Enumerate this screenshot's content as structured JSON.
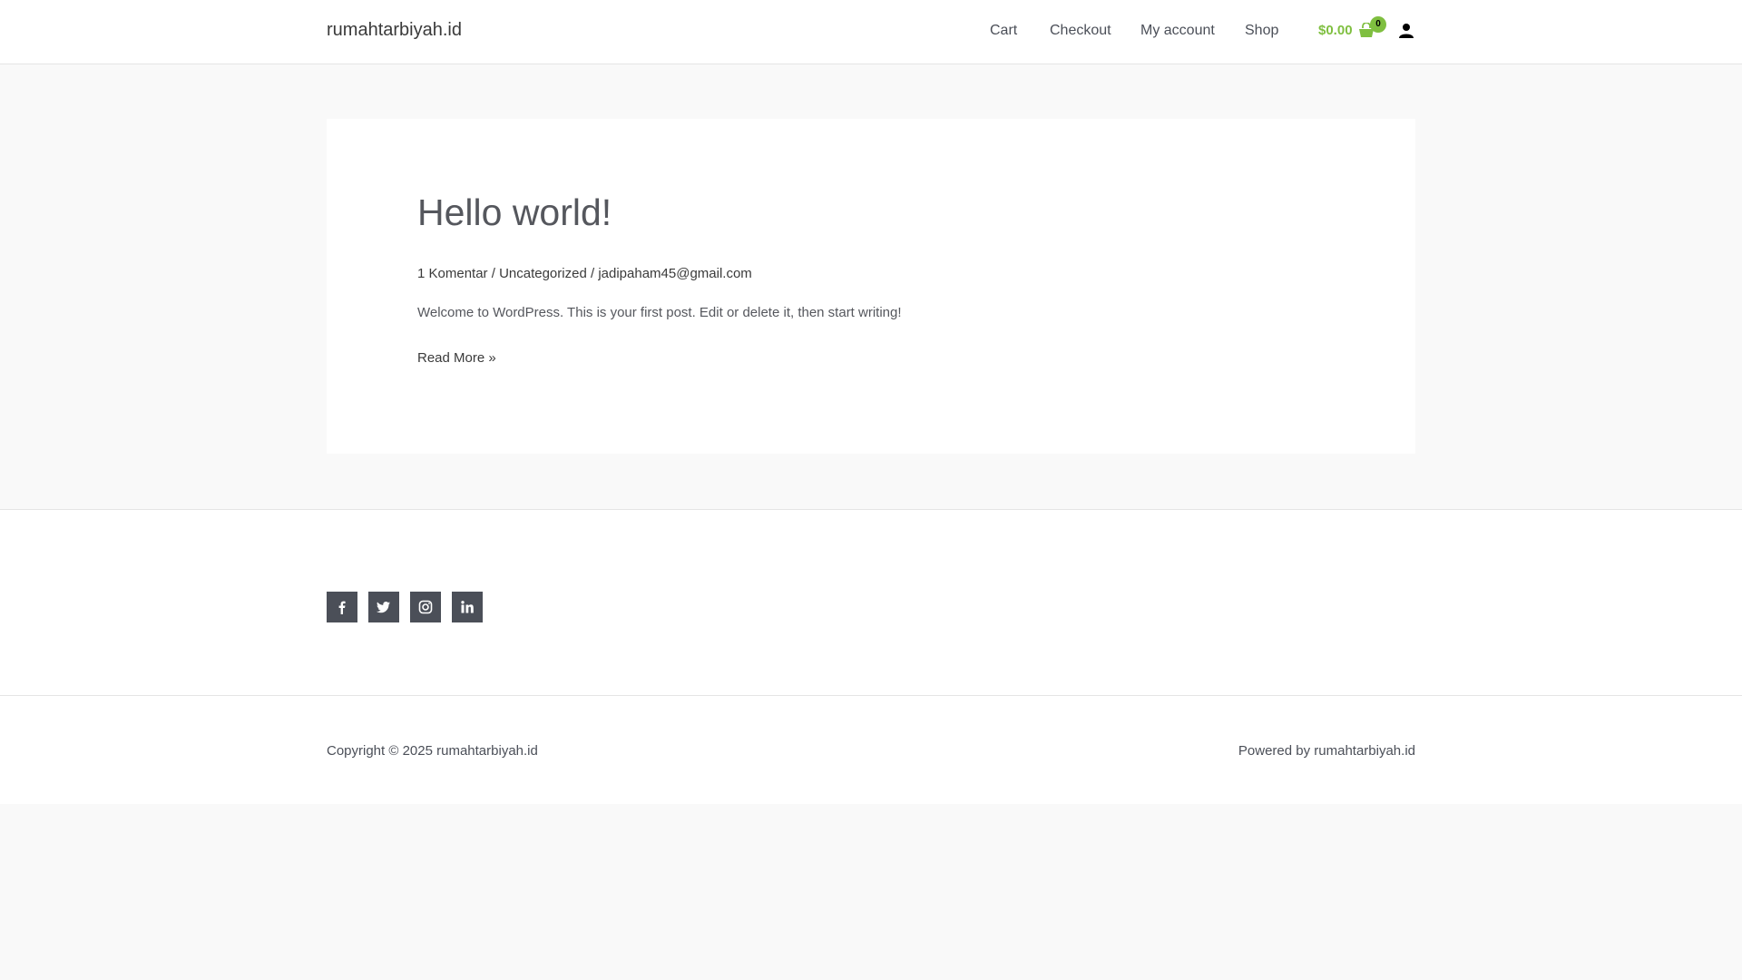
{
  "header": {
    "site_title": "rumahtarbiyah.id",
    "nav": [
      "Cart",
      "Checkout",
      "My account",
      "Shop"
    ],
    "cart_total": "$0.00",
    "cart_count": "0",
    "accent_color": "#7fbf40"
  },
  "post": {
    "title": "Hello world!",
    "comments": "1 Komentar",
    "separator": "/",
    "category": "Uncategorized",
    "author": "jadipaham45@gmail.com",
    "excerpt": "Welcome to WordPress. This is your first post. Edit or delete it, then start writing!",
    "read_more": "Read More »"
  },
  "social": {
    "icons": [
      "facebook-icon",
      "twitter-icon",
      "instagram-icon",
      "linkedin-icon"
    ],
    "background_color": "#4b4f58"
  },
  "footer": {
    "copyright": "Copyright © 2025 rumahtarbiyah.id",
    "powered": "Powered by rumahtarbiyah.id"
  }
}
